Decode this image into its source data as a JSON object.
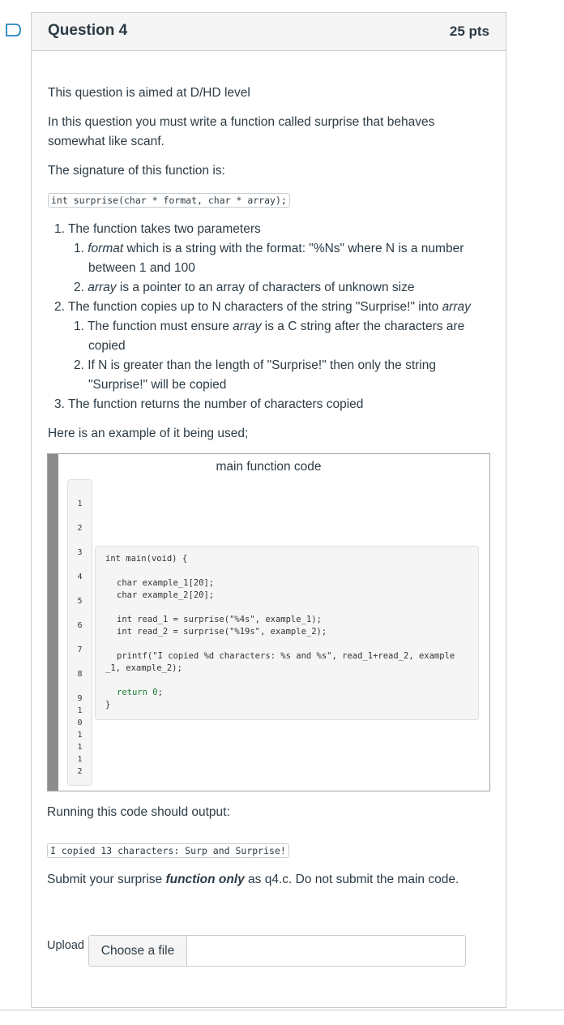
{
  "header": {
    "title": "Question 4",
    "points": "25 pts"
  },
  "intro": {
    "line1": "This question is aimed at D/HD level",
    "line2a": "In this question you must write a function called surprise that behaves",
    "line2b": "somewhat like scanf.",
    "line3": "The signature of this function is:",
    "signature": "int surprise(char * format, char * array);"
  },
  "list": {
    "i1": "1. The function takes two parameters",
    "i1_1_em": "format",
    "i1_1_rest": " which is a string with the format: \"%Ns\" where N is a number",
    "i1_1_cont": "between 1 and 100",
    "i1_2_em": "array",
    "i1_2_rest": " is a pointer to an array of characters of unknown size",
    "i2": "2. The function copies up to N characters of the string \"Surprise!\" into ",
    "i2_em": "array",
    "i2_1_a": "1. The function must ensure ",
    "i2_1_em": "array",
    "i2_1_b": " is a C string after the characters are",
    "i2_1_cont": "copied",
    "i2_2": "2. If N is greater than the length of \"Surprise!\" then only the string",
    "i2_2_cont": "\"Surprise!\" will be copied",
    "i3": "3. The function returns the number of characters copied",
    "n1_1": "1. ",
    "n1_2": "2. "
  },
  "example_intro": "Here is an example of it being used;",
  "codebox": {
    "title": "main function code",
    "line_numbers": [
      "1",
      "2",
      "3",
      "4",
      "5",
      "6",
      "7",
      "8",
      "9",
      "1",
      "0",
      "1",
      "1",
      "1",
      "2"
    ],
    "code": {
      "l1": "int main(void) {",
      "l2": "char example_1[20];",
      "l3": "char example_2[20];",
      "l4": "int read_1 = surprise(\"%4s\", example_1);",
      "l5": "int read_2 = surprise(\"%19s\", example_2);",
      "l6": "printf(\"I copied %d characters: %s and %s\", read_1+read_2, example",
      "l7": "_1, example_2);",
      "l8a": "return ",
      "l8b": "0",
      "l8c": ";",
      "l9": "}"
    }
  },
  "output_intro": "Running this code should output:",
  "output": "I copied 13 characters: Surp and Surprise!",
  "submit": {
    "pre": "Submit your surprise ",
    "em": "function only",
    "post": " as q4.c. Do not submit the main code."
  },
  "upload": {
    "label": "Upload",
    "button": "Choose a file"
  },
  "colors": {
    "accent": "#0374b5",
    "border": "#c7cdd1"
  }
}
